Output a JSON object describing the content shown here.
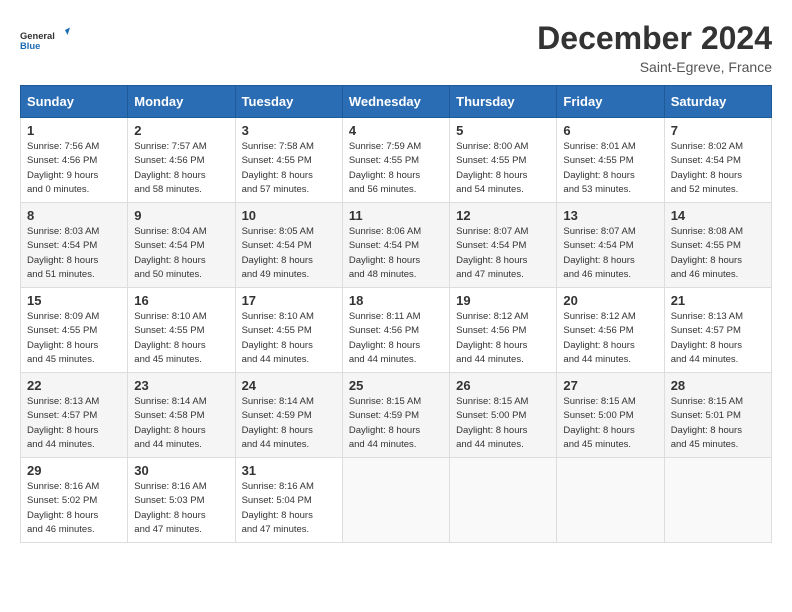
{
  "logo": {
    "line1": "General",
    "line2": "Blue"
  },
  "title": "December 2024",
  "subtitle": "Saint-Egreve, France",
  "headers": [
    "Sunday",
    "Monday",
    "Tuesday",
    "Wednesday",
    "Thursday",
    "Friday",
    "Saturday"
  ],
  "weeks": [
    [
      {
        "day": "1",
        "info": "Sunrise: 7:56 AM\nSunset: 4:56 PM\nDaylight: 9 hours\nand 0 minutes."
      },
      {
        "day": "2",
        "info": "Sunrise: 7:57 AM\nSunset: 4:56 PM\nDaylight: 8 hours\nand 58 minutes."
      },
      {
        "day": "3",
        "info": "Sunrise: 7:58 AM\nSunset: 4:55 PM\nDaylight: 8 hours\nand 57 minutes."
      },
      {
        "day": "4",
        "info": "Sunrise: 7:59 AM\nSunset: 4:55 PM\nDaylight: 8 hours\nand 56 minutes."
      },
      {
        "day": "5",
        "info": "Sunrise: 8:00 AM\nSunset: 4:55 PM\nDaylight: 8 hours\nand 54 minutes."
      },
      {
        "day": "6",
        "info": "Sunrise: 8:01 AM\nSunset: 4:55 PM\nDaylight: 8 hours\nand 53 minutes."
      },
      {
        "day": "7",
        "info": "Sunrise: 8:02 AM\nSunset: 4:54 PM\nDaylight: 8 hours\nand 52 minutes."
      }
    ],
    [
      {
        "day": "8",
        "info": "Sunrise: 8:03 AM\nSunset: 4:54 PM\nDaylight: 8 hours\nand 51 minutes."
      },
      {
        "day": "9",
        "info": "Sunrise: 8:04 AM\nSunset: 4:54 PM\nDaylight: 8 hours\nand 50 minutes."
      },
      {
        "day": "10",
        "info": "Sunrise: 8:05 AM\nSunset: 4:54 PM\nDaylight: 8 hours\nand 49 minutes."
      },
      {
        "day": "11",
        "info": "Sunrise: 8:06 AM\nSunset: 4:54 PM\nDaylight: 8 hours\nand 48 minutes."
      },
      {
        "day": "12",
        "info": "Sunrise: 8:07 AM\nSunset: 4:54 PM\nDaylight: 8 hours\nand 47 minutes."
      },
      {
        "day": "13",
        "info": "Sunrise: 8:07 AM\nSunset: 4:54 PM\nDaylight: 8 hours\nand 46 minutes."
      },
      {
        "day": "14",
        "info": "Sunrise: 8:08 AM\nSunset: 4:55 PM\nDaylight: 8 hours\nand 46 minutes."
      }
    ],
    [
      {
        "day": "15",
        "info": "Sunrise: 8:09 AM\nSunset: 4:55 PM\nDaylight: 8 hours\nand 45 minutes."
      },
      {
        "day": "16",
        "info": "Sunrise: 8:10 AM\nSunset: 4:55 PM\nDaylight: 8 hours\nand 45 minutes."
      },
      {
        "day": "17",
        "info": "Sunrise: 8:10 AM\nSunset: 4:55 PM\nDaylight: 8 hours\nand 44 minutes."
      },
      {
        "day": "18",
        "info": "Sunrise: 8:11 AM\nSunset: 4:56 PM\nDaylight: 8 hours\nand 44 minutes."
      },
      {
        "day": "19",
        "info": "Sunrise: 8:12 AM\nSunset: 4:56 PM\nDaylight: 8 hours\nand 44 minutes."
      },
      {
        "day": "20",
        "info": "Sunrise: 8:12 AM\nSunset: 4:56 PM\nDaylight: 8 hours\nand 44 minutes."
      },
      {
        "day": "21",
        "info": "Sunrise: 8:13 AM\nSunset: 4:57 PM\nDaylight: 8 hours\nand 44 minutes."
      }
    ],
    [
      {
        "day": "22",
        "info": "Sunrise: 8:13 AM\nSunset: 4:57 PM\nDaylight: 8 hours\nand 44 minutes."
      },
      {
        "day": "23",
        "info": "Sunrise: 8:14 AM\nSunset: 4:58 PM\nDaylight: 8 hours\nand 44 minutes."
      },
      {
        "day": "24",
        "info": "Sunrise: 8:14 AM\nSunset: 4:59 PM\nDaylight: 8 hours\nand 44 minutes."
      },
      {
        "day": "25",
        "info": "Sunrise: 8:15 AM\nSunset: 4:59 PM\nDaylight: 8 hours\nand 44 minutes."
      },
      {
        "day": "26",
        "info": "Sunrise: 8:15 AM\nSunset: 5:00 PM\nDaylight: 8 hours\nand 44 minutes."
      },
      {
        "day": "27",
        "info": "Sunrise: 8:15 AM\nSunset: 5:00 PM\nDaylight: 8 hours\nand 45 minutes."
      },
      {
        "day": "28",
        "info": "Sunrise: 8:15 AM\nSunset: 5:01 PM\nDaylight: 8 hours\nand 45 minutes."
      }
    ],
    [
      {
        "day": "29",
        "info": "Sunrise: 8:16 AM\nSunset: 5:02 PM\nDaylight: 8 hours\nand 46 minutes."
      },
      {
        "day": "30",
        "info": "Sunrise: 8:16 AM\nSunset: 5:03 PM\nDaylight: 8 hours\nand 47 minutes."
      },
      {
        "day": "31",
        "info": "Sunrise: 8:16 AM\nSunset: 5:04 PM\nDaylight: 8 hours\nand 47 minutes."
      },
      null,
      null,
      null,
      null
    ]
  ]
}
